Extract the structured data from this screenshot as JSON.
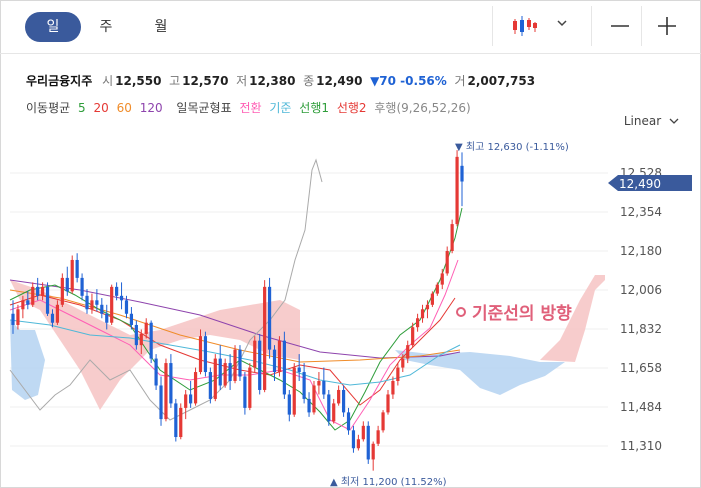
{
  "tabs": [
    "일",
    "주",
    "월"
  ],
  "toolbar": {
    "chart_type_icon": "candlestick-icon",
    "dropdown_icon": "chevron-down-icon",
    "minimize_icon": "minus-icon",
    "add_icon": "plus-icon"
  },
  "stock": {
    "name": "우리금융지주",
    "open_label": "시",
    "open": "12,550",
    "high_label": "고",
    "high": "12,570",
    "low_label": "저",
    "low": "12,380",
    "close_label": "종",
    "close": "12,490",
    "change": "▼70 -0.56%",
    "volume_label": "거",
    "volume": "2,007,753"
  },
  "indicators": {
    "ma_label": "이동평균",
    "ma5": "5",
    "ma20": "20",
    "ma60": "60",
    "ma120": "120",
    "ichimoku_label": "일목균형표",
    "conversion": "전환",
    "base": "기준",
    "lead1": "선행1",
    "lead2": "선행2",
    "lagging": "후행(9,26,52,26)"
  },
  "scale_label": "Linear",
  "colors": {
    "up": "#e53935",
    "down": "#1f62d4",
    "ma5": "#2e9d3a",
    "ma20": "#e53935",
    "ma60": "#f08c2a",
    "ma120": "#8e44ad",
    "conversion": "#ff5fb5",
    "base": "#4fb8d8",
    "lead1": "#2e9d3a",
    "lead2": "#e53935",
    "lagging": "#aaaaaa",
    "cloud_red": "#f6c3c3",
    "cloud_blue": "#b8d5f2",
    "price_badge": "#3a5a9c",
    "annotation": "#e0607a"
  },
  "chart_data": {
    "type": "candlestick",
    "y_ticks": [
      "12,528",
      "12,354",
      "12,180",
      "12,006",
      "11,832",
      "11,658",
      "11,484",
      "11,310"
    ],
    "current_price": "12,490",
    "high_marker": "최고 12,630 (-1.11%)",
    "low_marker": "최저 11,200 (11.52%)",
    "annotation": "기준선의 방향",
    "ohlc": [
      [
        11900,
        11960,
        11810,
        11850
      ],
      [
        11850,
        11940,
        11830,
        11920
      ],
      [
        11920,
        11980,
        11880,
        11960
      ],
      [
        11960,
        12000,
        11920,
        11940
      ],
      [
        11940,
        12040,
        11930,
        12020
      ],
      [
        12020,
        12060,
        11960,
        11980
      ],
      [
        11980,
        12040,
        11960,
        12020
      ],
      [
        12020,
        12040,
        11890,
        11900
      ],
      [
        11900,
        11920,
        11840,
        11860
      ],
      [
        11860,
        11960,
        11850,
        11940
      ],
      [
        11940,
        12080,
        11930,
        12060
      ],
      [
        12060,
        12110,
        11980,
        12000
      ],
      [
        12000,
        12160,
        11990,
        12140
      ],
      [
        12140,
        12170,
        12040,
        12060
      ],
      [
        12060,
        12080,
        11960,
        11980
      ],
      [
        11980,
        12010,
        11900,
        11920
      ],
      [
        11920,
        11990,
        11900,
        11960
      ],
      [
        11960,
        12010,
        11910,
        11940
      ],
      [
        11940,
        11970,
        11880,
        11900
      ],
      [
        11900,
        11940,
        11830,
        11860
      ],
      [
        11860,
        12030,
        11850,
        12020
      ],
      [
        12020,
        12040,
        11960,
        11980
      ],
      [
        11980,
        12040,
        11920,
        11960
      ],
      [
        11960,
        11980,
        11880,
        11900
      ],
      [
        11900,
        11930,
        11830,
        11850
      ],
      [
        11850,
        11870,
        11740,
        11760
      ],
      [
        11760,
        11830,
        11720,
        11810
      ],
      [
        11810,
        11880,
        11790,
        11860
      ],
      [
        11860,
        11870,
        11680,
        11700
      ],
      [
        11700,
        11720,
        11560,
        11580
      ],
      [
        11580,
        11620,
        11400,
        11430
      ],
      [
        11430,
        11700,
        11420,
        11680
      ],
      [
        11680,
        11720,
        11480,
        11500
      ],
      [
        11500,
        11520,
        11330,
        11350
      ],
      [
        11350,
        11500,
        11340,
        11480
      ],
      [
        11480,
        11560,
        11430,
        11540
      ],
      [
        11540,
        11600,
        11480,
        11500
      ],
      [
        11500,
        11660,
        11490,
        11640
      ],
      [
        11640,
        11830,
        11630,
        11800
      ],
      [
        11800,
        11820,
        11620,
        11640
      ],
      [
        11640,
        11660,
        11500,
        11520
      ],
      [
        11520,
        11720,
        11510,
        11700
      ],
      [
        11700,
        11760,
        11560,
        11580
      ],
      [
        11580,
        11700,
        11570,
        11680
      ],
      [
        11680,
        11720,
        11560,
        11600
      ],
      [
        11600,
        11760,
        11590,
        11740
      ],
      [
        11740,
        11760,
        11600,
        11620
      ],
      [
        11620,
        11640,
        11450,
        11480
      ],
      [
        11480,
        11680,
        11470,
        11660
      ],
      [
        11660,
        11800,
        11640,
        11780
      ],
      [
        11780,
        11810,
        11540,
        11560
      ],
      [
        11560,
        12050,
        11550,
        12020
      ],
      [
        12020,
        12060,
        11700,
        11740
      ],
      [
        11740,
        11760,
        11600,
        11640
      ],
      [
        11640,
        11800,
        11620,
        11780
      ],
      [
        11780,
        11820,
        11520,
        11540
      ],
      [
        11540,
        11560,
        11420,
        11450
      ],
      [
        11450,
        11680,
        11440,
        11660
      ],
      [
        11660,
        11720,
        11600,
        11640
      ],
      [
        11640,
        11680,
        11500,
        11520
      ],
      [
        11520,
        11550,
        11440,
        11460
      ],
      [
        11460,
        11600,
        11450,
        11580
      ],
      [
        11580,
        11640,
        11540,
        11600
      ],
      [
        11600,
        11660,
        11520,
        11540
      ],
      [
        11540,
        11560,
        11400,
        11420
      ],
      [
        11420,
        11520,
        11410,
        11500
      ],
      [
        11500,
        11580,
        11490,
        11560
      ],
      [
        11560,
        11580,
        11440,
        11460
      ],
      [
        11460,
        11480,
        11360,
        11380
      ],
      [
        11380,
        11400,
        11280,
        11300
      ],
      [
        11300,
        11360,
        11290,
        11340
      ],
      [
        11340,
        11420,
        11330,
        11400
      ],
      [
        11400,
        11420,
        11230,
        11250
      ],
      [
        11250,
        11330,
        11200,
        11320
      ],
      [
        11320,
        11400,
        11310,
        11380
      ],
      [
        11380,
        11470,
        11370,
        11460
      ],
      [
        11460,
        11560,
        11450,
        11540
      ],
      [
        11540,
        11620,
        11520,
        11600
      ],
      [
        11600,
        11680,
        11580,
        11660
      ],
      [
        11660,
        11720,
        11640,
        11700
      ],
      [
        11700,
        11780,
        11680,
        11760
      ],
      [
        11760,
        11860,
        11750,
        11840
      ],
      [
        11840,
        11900,
        11820,
        11880
      ],
      [
        11880,
        11940,
        11860,
        11920
      ],
      [
        11920,
        11960,
        11880,
        11940
      ],
      [
        11940,
        12000,
        11930,
        11990
      ],
      [
        11990,
        12040,
        11980,
        12030
      ],
      [
        12030,
        12100,
        12010,
        12080
      ],
      [
        12080,
        12200,
        12070,
        12180
      ],
      [
        12180,
        12320,
        12170,
        12300
      ],
      [
        12300,
        12630,
        12290,
        12600
      ],
      [
        12560,
        12620,
        12380,
        12490
      ]
    ]
  }
}
